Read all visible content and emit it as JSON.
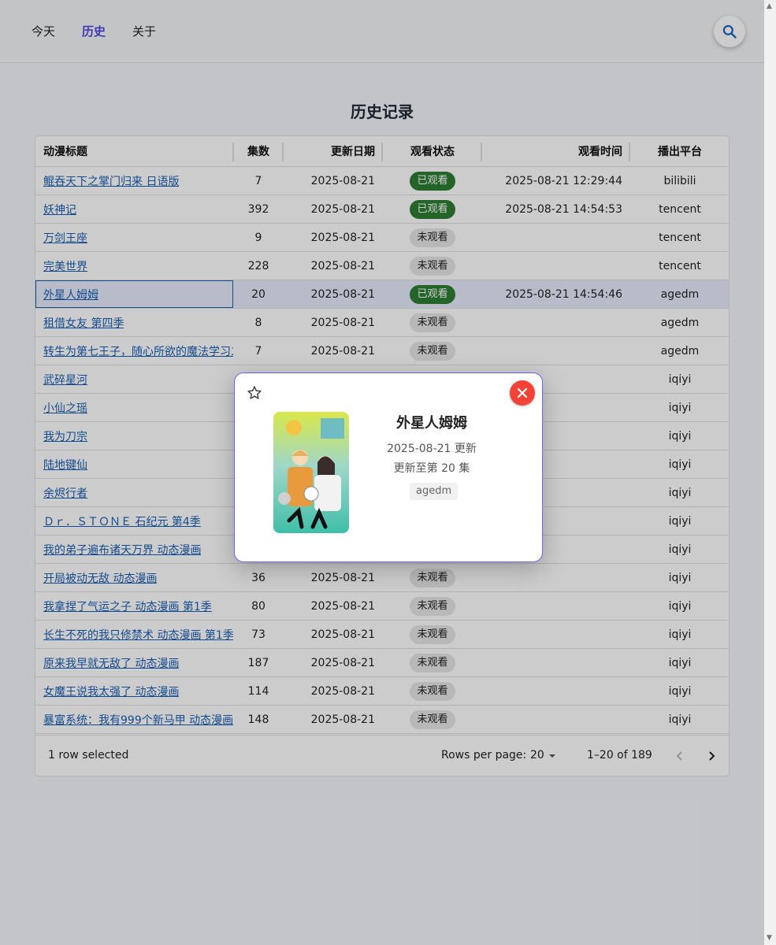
{
  "nav": {
    "items": [
      "今天",
      "历史",
      "关于"
    ],
    "active": "历史"
  },
  "page": {
    "title": "历史记录"
  },
  "table": {
    "columns": [
      "动漫标题",
      "集数",
      "更新日期",
      "观看状态",
      "观看时间",
      "播出平台"
    ],
    "rows": [
      {
        "title": "鲲吞天下之掌门归来 日语版",
        "episodes": "7",
        "date": "2025-08-21",
        "status": "已观看",
        "watched": true,
        "time": "2025-08-21 12:29:44",
        "platform": "bilibili"
      },
      {
        "title": "妖神记",
        "episodes": "392",
        "date": "2025-08-21",
        "status": "已观看",
        "watched": true,
        "time": "2025-08-21 14:54:53",
        "platform": "tencent"
      },
      {
        "title": "万剑王座",
        "episodes": "9",
        "date": "2025-08-21",
        "status": "未观看",
        "watched": false,
        "time": "",
        "platform": "tencent"
      },
      {
        "title": "完美世界",
        "episodes": "228",
        "date": "2025-08-21",
        "status": "未观看",
        "watched": false,
        "time": "",
        "platform": "tencent"
      },
      {
        "title": "外星人姆姆",
        "episodes": "20",
        "date": "2025-08-21",
        "status": "已观看",
        "watched": true,
        "time": "2025-08-21 14:54:46",
        "platform": "agedm",
        "selected": true
      },
      {
        "title": "租借女友 第四季",
        "episodes": "8",
        "date": "2025-08-21",
        "status": "未观看",
        "watched": false,
        "time": "",
        "platform": "agedm"
      },
      {
        "title": "转生为第七王子，随心所欲的魔法学习之路",
        "episodes": "7",
        "date": "2025-08-21",
        "status": "未观看",
        "watched": false,
        "time": "",
        "platform": "agedm"
      },
      {
        "title": "武碎星河",
        "episodes": "",
        "date": "",
        "status": "",
        "watched": false,
        "time": "",
        "platform": "iqiyi"
      },
      {
        "title": "小仙之瑶",
        "episodes": "",
        "date": "",
        "status": "",
        "watched": false,
        "time": "",
        "platform": "iqiyi"
      },
      {
        "title": "我为刀宗",
        "episodes": "",
        "date": "",
        "status": "",
        "watched": false,
        "time": "",
        "platform": "iqiyi"
      },
      {
        "title": "陆地键仙",
        "episodes": "",
        "date": "",
        "status": "",
        "watched": false,
        "time": "",
        "platform": "iqiyi"
      },
      {
        "title": "余烬行者",
        "episodes": "",
        "date": "",
        "status": "",
        "watched": false,
        "time": "",
        "platform": "iqiyi"
      },
      {
        "title": "Ｄｒ．ＳＴＯＮＥ 石纪元 第4季",
        "episodes": "",
        "date": "",
        "status": "",
        "watched": false,
        "time": "",
        "platform": "iqiyi"
      },
      {
        "title": "我的弟子遍布诸天万界 动态漫画",
        "episodes": "",
        "date": "",
        "status": "",
        "watched": false,
        "time": "",
        "platform": "iqiyi"
      },
      {
        "title": "开局被动无敌 动态漫画",
        "episodes": "36",
        "date": "2025-08-21",
        "status": "未观看",
        "watched": false,
        "time": "",
        "platform": "iqiyi"
      },
      {
        "title": "我拿捏了气运之子 动态漫画 第1季",
        "episodes": "80",
        "date": "2025-08-21",
        "status": "未观看",
        "watched": false,
        "time": "",
        "platform": "iqiyi"
      },
      {
        "title": "长生不死的我只修禁术 动态漫画 第1季",
        "episodes": "73",
        "date": "2025-08-21",
        "status": "未观看",
        "watched": false,
        "time": "",
        "platform": "iqiyi"
      },
      {
        "title": "原来我早就无敌了 动态漫画",
        "episodes": "187",
        "date": "2025-08-21",
        "status": "未观看",
        "watched": false,
        "time": "",
        "platform": "iqiyi"
      },
      {
        "title": "女魔王说我太强了 动态漫画",
        "episodes": "114",
        "date": "2025-08-21",
        "status": "未观看",
        "watched": false,
        "time": "",
        "platform": "iqiyi"
      },
      {
        "title": "暴富系统：我有999个新马甲 动态漫画",
        "episodes": "148",
        "date": "2025-08-21",
        "status": "未观看",
        "watched": false,
        "time": "",
        "platform": "iqiyi"
      }
    ]
  },
  "footer": {
    "selected_text": "1 row selected",
    "rows_per_page_label": "Rows per page:",
    "rows_per_page_value": "20",
    "range_text": "1–20 of 189"
  },
  "modal": {
    "title": "外星人姆姆",
    "update_line": "2025-08-21 更新",
    "episode_line": "更新至第 20 集",
    "platform_tag": "agedm"
  },
  "colors": {
    "accent": "#4f46e5",
    "watched": "#2e7d32",
    "link": "#1a5fb4",
    "close": "#f44336",
    "modal_border": "#6366f1"
  },
  "icons": {
    "search": "search-icon",
    "star": "star-outline-icon",
    "close": "close-icon",
    "dropdown": "caret-down-icon",
    "prev": "chevron-left-icon",
    "next": "chevron-right-icon"
  }
}
